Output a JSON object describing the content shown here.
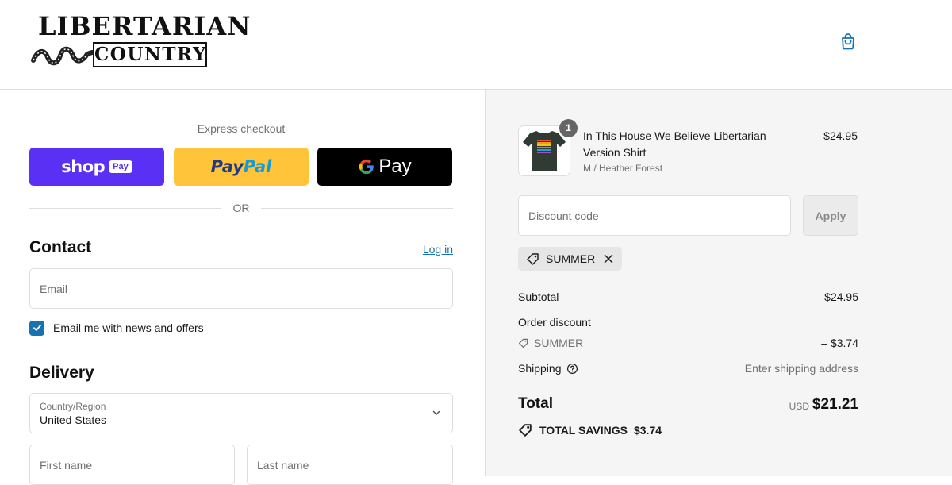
{
  "header": {
    "logo_line1": "LIBERTARIAN",
    "logo_line2": "COUNTRY",
    "cart_icon": "shopping-bag-icon",
    "accent_color": "#1773b0"
  },
  "express": {
    "label": "Express checkout",
    "shop_pay": {
      "word": "shop",
      "badge": "Pay",
      "color": "#5a31f4"
    },
    "paypal": {
      "part1": "Pay",
      "part2": "Pal",
      "color": "#ffc439"
    },
    "gpay": {
      "word": "Pay",
      "color": "#000000"
    },
    "divider_text": "OR"
  },
  "contact": {
    "title": "Contact",
    "login_link": "Log in",
    "email_placeholder": "Email",
    "newsletter_label": "Email me with news and offers",
    "newsletter_checked": true
  },
  "delivery": {
    "title": "Delivery",
    "country_label": "Country/Region",
    "country_value": "United States",
    "first_name_placeholder": "First name",
    "last_name_placeholder": "Last name"
  },
  "order": {
    "item": {
      "quantity": "1",
      "name": "In This House We Believe Libertarian Version Shirt",
      "variant": "M / Heather Forest",
      "price": "$24.95",
      "shirt_color": "#2f3b33"
    },
    "discount_placeholder": "Discount code",
    "apply_label": "Apply",
    "applied_code": "SUMMER",
    "subtotal_label": "Subtotal",
    "subtotal_value": "$24.95",
    "order_discount_label": "Order discount",
    "discount_code": "SUMMER",
    "discount_value": "– $3.74",
    "shipping_label": "Shipping",
    "shipping_value": "Enter shipping address",
    "total_label": "Total",
    "total_currency": "USD",
    "total_value": "$21.21",
    "savings_label": "TOTAL SAVINGS",
    "savings_value": "$3.74"
  }
}
